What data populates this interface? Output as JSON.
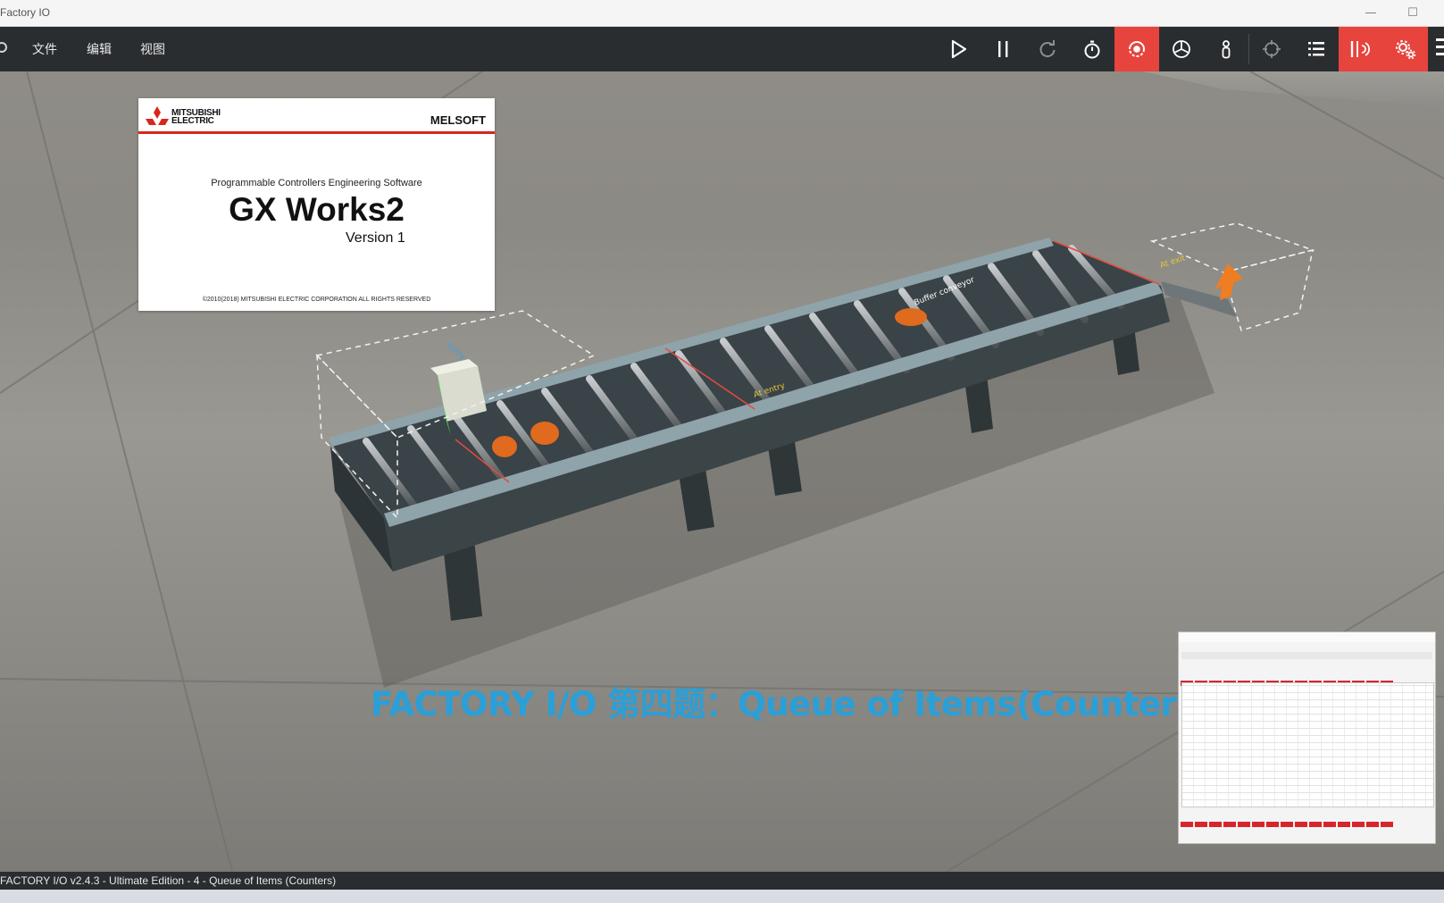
{
  "window": {
    "title": "Factory IO",
    "minimize_glyph": "—",
    "maximize_glyph": "☐"
  },
  "menu": {
    "items": [
      "文件",
      "编辑",
      "视图"
    ]
  },
  "toolbar": {
    "buttons": [
      {
        "icon": "play-icon",
        "active": false
      },
      {
        "icon": "pause-icon",
        "active": false
      },
      {
        "icon": "reset-icon",
        "active": false
      },
      {
        "icon": "stopwatch-icon",
        "active": false
      },
      {
        "icon": "camera-orbit-icon",
        "active": true
      },
      {
        "icon": "camera-fly-icon",
        "active": false
      },
      {
        "icon": "first-person-icon",
        "active": false
      },
      {
        "icon": "target-icon",
        "active": false
      },
      {
        "icon": "list-icon",
        "active": false
      },
      {
        "icon": "sensor-signal-icon",
        "active": true
      },
      {
        "icon": "settings-gears-icon",
        "active": true
      }
    ],
    "active_color": "#e7443d"
  },
  "scene": {
    "sensor_labels": [
      "At entry",
      "At exit",
      "Entry",
      "Buffer conveyor"
    ]
  },
  "splash": {
    "brand_line1": "MITSUBISHI",
    "brand_line2": "ELECTRIC",
    "product_family": "MELSOFT",
    "subtitle": "Programmable Controllers Engineering Software",
    "title": "GX Works2",
    "version": "Version 1",
    "copyright": "©2010(2018) MITSUBISHI ELECTRIC CORPORATION ALL RIGHTS RESERVED"
  },
  "caption": "FACTORY I/O 第四题：Queue of Items(Counters)",
  "caption_color": "#2a9fd8",
  "status": {
    "text": "FACTORY I/O v2.4.3 - Ultimate Edition - 4 - Queue of Items (Counters)"
  }
}
